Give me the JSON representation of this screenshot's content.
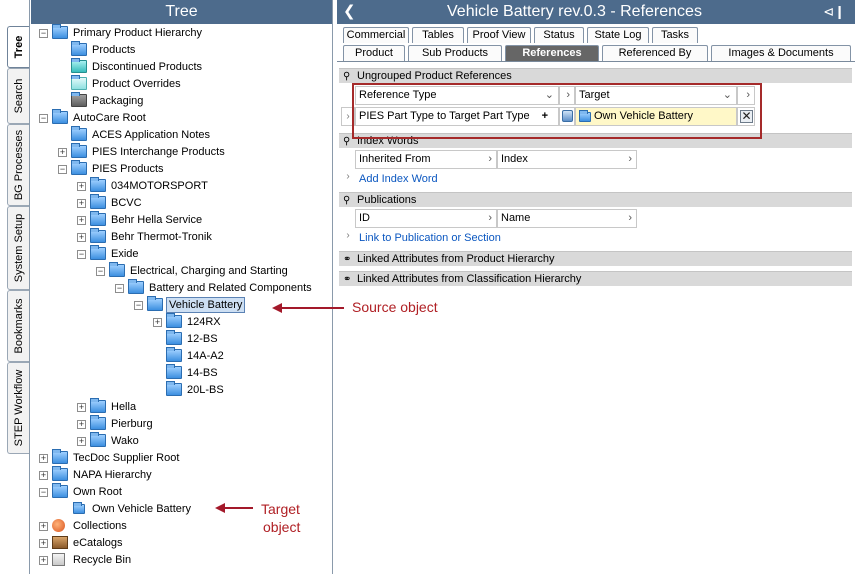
{
  "left_tabs": [
    "Tree",
    "Search",
    "BG Processes",
    "System Setup",
    "Bookmarks",
    "STEP Workflow"
  ],
  "tree": {
    "title": "Tree",
    "nodes": [
      "Primary Product Hierarchy",
      "Products",
      "Discontinued Products",
      "Product Overrides",
      "Packaging",
      "AutoCare Root",
      "ACES Application Notes",
      "PIES Interchange Products",
      "PIES Products",
      "034MOTORSPORT",
      "BCVC",
      "Behr Hella Service",
      "Behr Thermot-Tronik",
      "Exide",
      "Electrical, Charging and Starting",
      "Battery and Related Components",
      "Vehicle Battery",
      "124RX",
      "12-BS",
      "14A-A2",
      "14-BS",
      "20L-BS",
      "Hella",
      "Pierburg",
      "Wako",
      "TecDoc Supplier Root",
      "NAPA Hierarchy",
      "Own Root",
      "Own Vehicle Battery",
      "Collections",
      "eCatalogs",
      "Recycle Bin"
    ]
  },
  "detail": {
    "title": "Vehicle Battery rev.0.3 - References",
    "tabs_row1": [
      "Commercial",
      "Tables",
      "Proof View",
      "Status",
      "State Log",
      "Tasks"
    ],
    "tabs_row2": [
      "Product",
      "Sub Products",
      "References",
      "Referenced By",
      "Images & Documents"
    ],
    "active_tab": "References",
    "sections": {
      "ungrouped": "Ungrouped Product References",
      "index_words": "Index Words",
      "publications": "Publications",
      "linked_product": "Linked Attributes from Product Hierarchy",
      "linked_classification": "Linked Attributes from Classification Hierarchy"
    },
    "ungrouped_headers": [
      "Reference Type",
      "Target"
    ],
    "ungrouped_row": {
      "type": "PIES Part Type to Target Part Type",
      "plus": "+",
      "target": "Own Vehicle Battery"
    },
    "index_headers": [
      "Inherited From",
      "Index"
    ],
    "index_link": "Add Index Word",
    "pub_headers": [
      "ID",
      "Name"
    ],
    "pub_link": "Link to Publication or Section"
  },
  "annotations": {
    "source": "Source object",
    "target_line1": "Target",
    "target_line2": "object"
  },
  "colors": {
    "header_bg": "#4d6b8c",
    "annotation": "#b02025",
    "target_highlight": "#fff8c8"
  }
}
